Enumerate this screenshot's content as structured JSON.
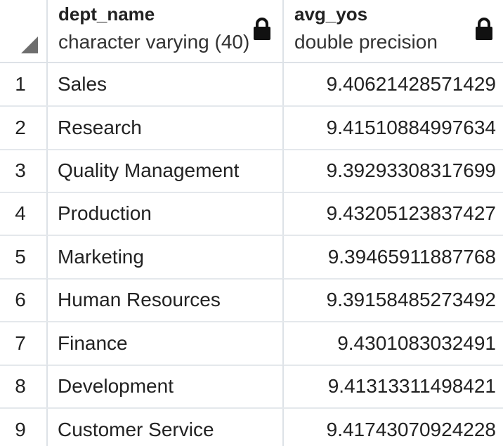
{
  "columns": [
    {
      "name": "dept_name",
      "type": "character varying (40)"
    },
    {
      "name": "avg_yos",
      "type": "double precision"
    }
  ],
  "rows": [
    {
      "num": "1",
      "dept_name": "Sales",
      "avg_yos": "9.40621428571429"
    },
    {
      "num": "2",
      "dept_name": "Research",
      "avg_yos": "9.41510884997634"
    },
    {
      "num": "3",
      "dept_name": "Quality Management",
      "avg_yos": "9.39293308317699"
    },
    {
      "num": "4",
      "dept_name": "Production",
      "avg_yos": "9.43205123837427"
    },
    {
      "num": "5",
      "dept_name": "Marketing",
      "avg_yos": "9.39465911887768"
    },
    {
      "num": "6",
      "dept_name": "Human Resources",
      "avg_yos": "9.39158485273492"
    },
    {
      "num": "7",
      "dept_name": "Finance",
      "avg_yos": "9.4301083032491"
    },
    {
      "num": "8",
      "dept_name": "Development",
      "avg_yos": "9.41313311498421"
    },
    {
      "num": "9",
      "dept_name": "Customer Service",
      "avg_yos": "9.41743070924228"
    }
  ],
  "icons": {
    "corner": "select-all-triangle-icon",
    "lock": "lock-icon"
  },
  "colors": {
    "grid_line": "#dde2e7",
    "corner_triangle": "#6e6e6e",
    "text": "#222222"
  }
}
